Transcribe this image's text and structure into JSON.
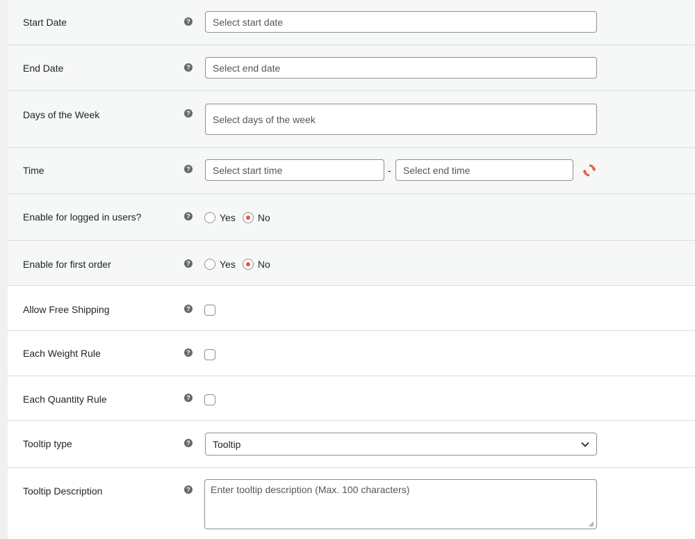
{
  "colors": {
    "accent": "#e8573f",
    "border": "#8c8f94",
    "row_gray": "#f6f7f7",
    "row_white": "#ffffff",
    "help_icon": "#646970"
  },
  "help_icon_glyph": "?",
  "rows": {
    "start_date": {
      "label": "Start Date",
      "placeholder": "Select start date"
    },
    "end_date": {
      "label": "End Date",
      "placeholder": "Select end date"
    },
    "days_of_week": {
      "label": "Days of the Week",
      "placeholder": "Select days of the week"
    },
    "time": {
      "label": "Time",
      "start_placeholder": "Select start time",
      "separator": "-",
      "end_placeholder": "Select end time",
      "reset_icon": "refresh-icon"
    },
    "logged_in_users": {
      "label": "Enable for logged in users?",
      "yes_label": "Yes",
      "no_label": "No",
      "selected": "No"
    },
    "first_order": {
      "label": "Enable for first order",
      "yes_label": "Yes",
      "no_label": "No",
      "selected": "No"
    },
    "free_shipping": {
      "label": "Allow Free Shipping",
      "checked": false
    },
    "weight_rule": {
      "label": "Each Weight Rule",
      "checked": false
    },
    "quantity_rule": {
      "label": "Each Quantity Rule",
      "checked": false
    },
    "tooltip_type": {
      "label": "Tooltip type",
      "selected": "Tooltip"
    },
    "tooltip_description": {
      "label": "Tooltip Description",
      "placeholder": "Enter tooltip description (Max. 100 characters)"
    }
  }
}
